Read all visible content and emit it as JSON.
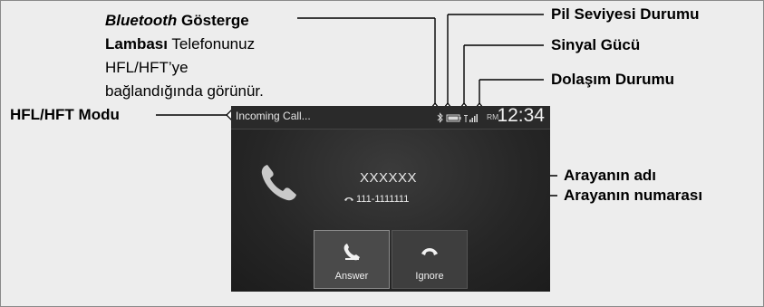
{
  "callouts": {
    "bluetooth_title_italic": "Bluetooth",
    "bluetooth_title_rest": " Gösterge",
    "bluetooth_line2_bold": "Lambası",
    "bluetooth_line2_rest": " Telefonunuz",
    "bluetooth_line3": "HFL/HFT’ye",
    "bluetooth_line4": "bağlandığında görünür.",
    "battery_status": "Pil Seviyesi Durumu",
    "signal_strength": "Sinyal Gücü",
    "roaming_status": "Dolaşım Durumu",
    "hfl_mode": "HFL/HFT Modu",
    "caller_name": "Arayanın adı",
    "caller_number": "Arayanın numarası"
  },
  "screen": {
    "status_text": "Incoming Call...",
    "roaming_badge": "RM",
    "time": "12:34",
    "caller_name": "XXXXXX",
    "caller_number": "111-1111111",
    "answer_label": "Answer",
    "ignore_label": "Ignore",
    "icons": [
      "bluetooth-icon",
      "battery-icon",
      "signal-icon",
      "phone-icon",
      "answer-phone-icon",
      "hangup-phone-icon"
    ]
  }
}
